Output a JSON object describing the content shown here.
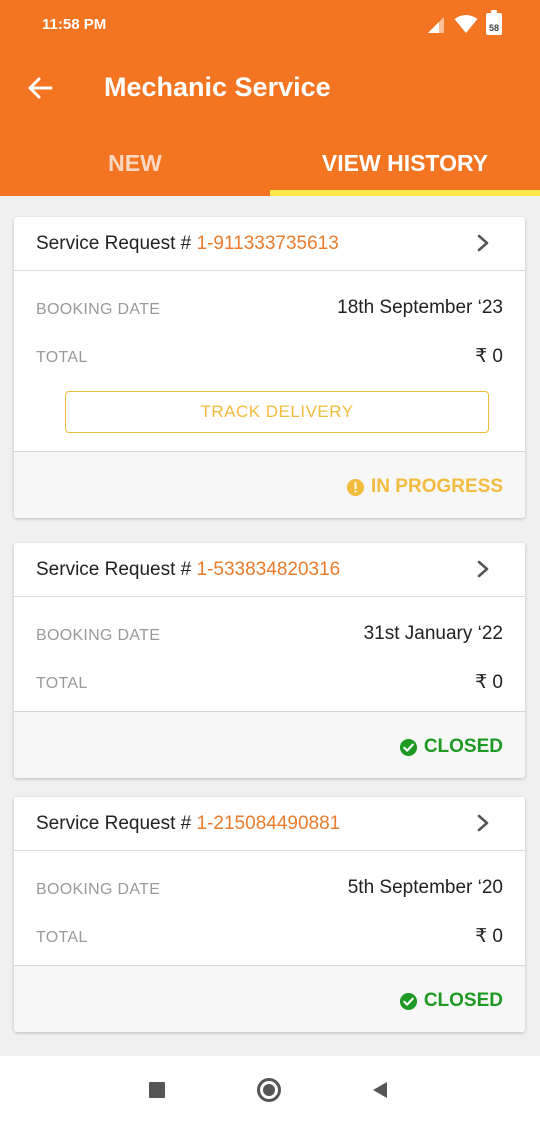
{
  "status_bar": {
    "time": "11:58 PM",
    "battery": "58"
  },
  "toolbar": {
    "title": "Mechanic Service"
  },
  "tabs": [
    {
      "label": "NEW",
      "active": false
    },
    {
      "label": "VIEW HISTORY",
      "active": true
    }
  ],
  "colors": {
    "brand": "#f37421",
    "tab_indicator": "#ffe94a",
    "in_progress": "#f2bc3e",
    "closed": "#1e9a24",
    "request_number": "#e87c2c"
  },
  "requests": [
    {
      "prefix": "Service Request # ",
      "number": "1-911333735613",
      "booking_label": "BOOKING DATE",
      "booking_date": "18th September ‘23",
      "total_label": "TOTAL",
      "total": "₹ 0",
      "action_label": "TRACK DELIVERY",
      "status": "IN PROGRESS",
      "status_icon": "alert-circle-icon"
    },
    {
      "prefix": "Service Request # ",
      "number": "1-533834820316",
      "booking_label": "BOOKING DATE",
      "booking_date": "31st January ‘22",
      "total_label": "TOTAL",
      "total": "₹ 0",
      "status": "CLOSED",
      "status_icon": "check-circle-icon"
    },
    {
      "prefix": "Service Request # ",
      "number": "1-215084490881",
      "booking_label": "BOOKING DATE",
      "booking_date": "5th September ‘20",
      "total_label": "TOTAL",
      "total": "₹ 0",
      "status": "CLOSED",
      "status_icon": "check-circle-icon"
    }
  ]
}
